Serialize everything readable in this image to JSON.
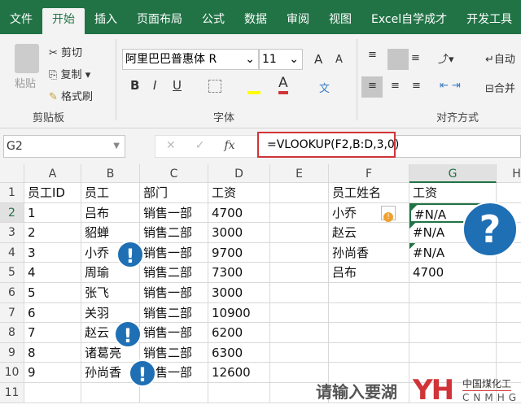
{
  "tabs": [
    "文件",
    "开始",
    "插入",
    "页面布局",
    "公式",
    "数据",
    "审阅",
    "视图",
    "Excel自学成才",
    "开发工具"
  ],
  "ribbon": {
    "paste": "粘贴",
    "cut": "剪切",
    "copy": "复制",
    "format_painter": "格式刷",
    "clipboard": "剪贴板",
    "font_name": "阿里巴巴普惠体 R",
    "font_size": "11",
    "font_group": "字体",
    "align_group": "对齐方式",
    "wrap": "自动",
    "merge": "合并",
    "bold": "B",
    "italic": "I",
    "underline": "U",
    "font_color": "A",
    "grow": "A",
    "shrink": "A",
    "phonetic": "文"
  },
  "formula_bar": {
    "name_box": "G2",
    "fx": "fx",
    "formula": "=VLOOKUP(F2,B:D,3,0)"
  },
  "columns": [
    "A",
    "B",
    "C",
    "D",
    "E",
    "F",
    "G",
    "H"
  ],
  "rows": [
    [
      "员工ID",
      "员工",
      "部门",
      "工资",
      "",
      "员工姓名",
      "工资"
    ],
    [
      "1",
      "吕布",
      "销售一部",
      "4700",
      "",
      "小乔",
      "#N/A"
    ],
    [
      "2",
      "貂蝉",
      "销售二部",
      "3000",
      "",
      "赵云",
      "#N/A"
    ],
    [
      "3",
      "小乔 ",
      "销售一部",
      "9700",
      "",
      "孙尚香",
      "#N/A"
    ],
    [
      "4",
      "周瑜",
      "销售二部",
      "7300",
      "",
      "吕布",
      "4700"
    ],
    [
      "5",
      "张飞",
      "销售一部",
      "3000",
      "",
      "",
      ""
    ],
    [
      "6",
      "关羽",
      "销售二部",
      "10900",
      "",
      "",
      ""
    ],
    [
      "7",
      "赵云 ",
      "销售一部",
      "6200",
      "",
      "",
      ""
    ],
    [
      "8",
      "诸葛亮",
      "销售二部",
      "6300",
      "",
      "",
      ""
    ],
    [
      "9",
      "孙尚香 ",
      "销售一部",
      "12600",
      "",
      "",
      ""
    ],
    [
      "",
      "",
      "",
      "",
      "",
      "",
      ""
    ]
  ],
  "overlay": {
    "question": "?",
    "bang": "!",
    "search_hint": "请输入要湖",
    "logo": "YH",
    "logo_cn": "中国煤化工",
    "logo_en": "CNMHG"
  },
  "colors": {
    "accent": "#217346",
    "callout": "#1f6fb4",
    "highlight": "#d13438"
  }
}
